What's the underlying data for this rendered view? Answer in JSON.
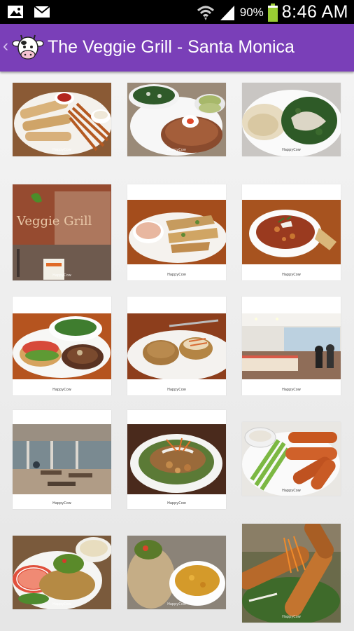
{
  "status_bar": {
    "icons": [
      "image-icon",
      "mail-icon",
      "wifi-icon",
      "signal-icon",
      "battery-icon"
    ],
    "battery": "90%",
    "time": "8:46 AM"
  },
  "header": {
    "title": "The Veggie Grill - Santa Monica",
    "back_glyph": "‹",
    "accent_color": "#7a3fb8"
  },
  "photos": [
    {
      "subject": "wrap-with-fries",
      "watermark": "HappyCow"
    },
    {
      "subject": "burger-with-kale-salad",
      "watermark": "HappyCow"
    },
    {
      "subject": "plate-with-kale-and-gravy",
      "watermark": "HappyCow"
    },
    {
      "subject": "restaurant-window-sign",
      "watermark": "HappyCow",
      "sign_text": "Veggie Grill"
    },
    {
      "subject": "chickin-strips-with-dip",
      "watermark": "HappyCow"
    },
    {
      "subject": "chili-bowl",
      "watermark": "HappyCow"
    },
    {
      "subject": "open-burger-with-salad",
      "watermark": "HappyCow"
    },
    {
      "subject": "crab-cakes",
      "watermark": "HappyCow"
    },
    {
      "subject": "restaurant-interior",
      "watermark": "HappyCow"
    },
    {
      "subject": "outdoor-patio",
      "watermark": "HappyCow"
    },
    {
      "subject": "loaded-salad-bowl",
      "watermark": "HappyCow"
    },
    {
      "subject": "buffalo-wings-with-celery",
      "watermark": "HappyCow"
    },
    {
      "subject": "sandwich-with-guacamole",
      "watermark": "HappyCow"
    },
    {
      "subject": "burrito-with-mac",
      "watermark": "HappyCow"
    },
    {
      "subject": "fried-strips-closeup",
      "watermark": "HappyCow"
    }
  ]
}
